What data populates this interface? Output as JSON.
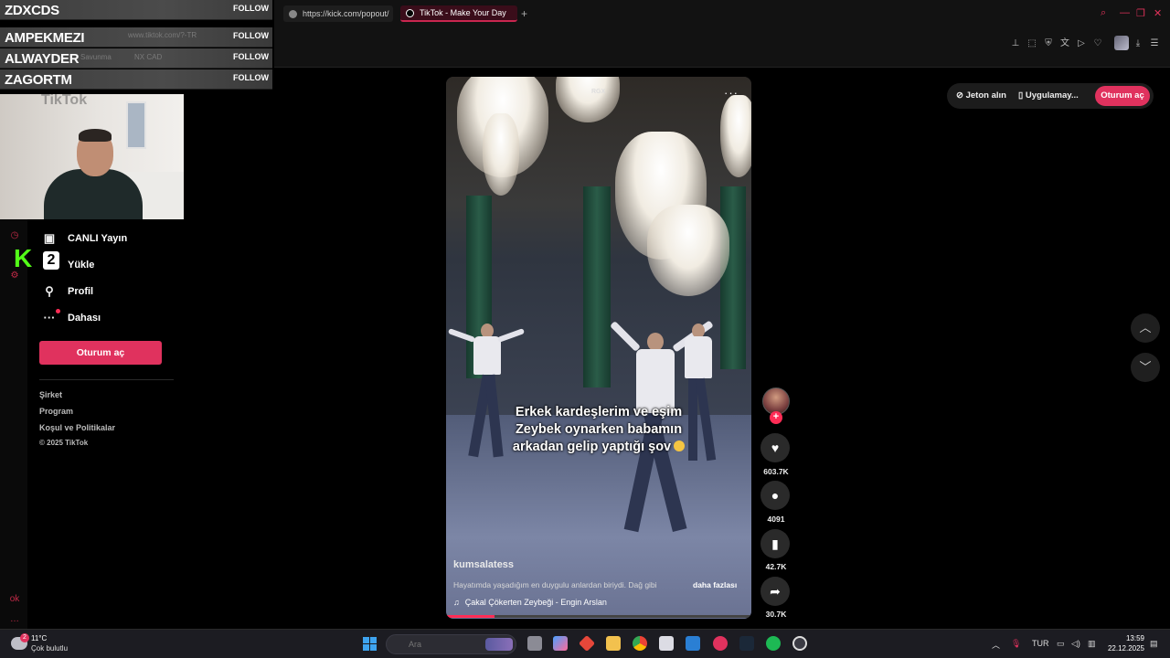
{
  "browser": {
    "tabs": [
      {
        "label": "https://kick.com/popout/"
      },
      {
        "label": "TikTok - Make Your Day"
      }
    ],
    "new_tab": "+"
  },
  "kick_overlay": {
    "followers": [
      {
        "name": "ZDXCDS",
        "action": "FOLLOW"
      },
      {
        "name": "AMPEKMEZI",
        "action": "FOLLOW"
      },
      {
        "name": "ALWAYDER",
        "action": "FOLLOW"
      },
      {
        "name": "ZAGORTM",
        "action": "FOLLOW"
      }
    ],
    "ghost_url": "www.tiktok.com/?-TR",
    "ghost_bar_1": "Savunma",
    "ghost_bar_2": "NX CAD",
    "ghost_logo": "TikTok"
  },
  "sidebar": {
    "items": [
      {
        "label": "CANLI Yayın",
        "icon": "live-icon"
      },
      {
        "label": "Yükle",
        "icon": "upload-icon"
      },
      {
        "label": "Profil",
        "icon": "profile-icon"
      },
      {
        "label": "Dahası",
        "icon": "more-icon"
      }
    ],
    "login_label": "Oturum aç",
    "footer": [
      "Şirket",
      "Program",
      "Koşul ve Politikalar"
    ],
    "copyright": "© 2025 TikTok",
    "kick_badge": "2"
  },
  "top_actions": {
    "coins_label": "Jeton alın",
    "app_label": "Uygulamay...",
    "login_label": "Oturum aç"
  },
  "video": {
    "watermark": "RGX",
    "menu": "···",
    "caption_lines": [
      "Erkek kardeşlerim ve eşim",
      "Zeybek oynarken babamın",
      "arkadan gelip yaptığı şov"
    ],
    "username": "kumsalatess",
    "description": "Hayatımda yaşadığım en duygulu anlardan biriydi. Dağ gibi",
    "more_label": "daha fazlası",
    "music": "Çakal Çökerten Zeybeği - Engin Arslan",
    "progress": 0.16
  },
  "actions": {
    "likes": "603.7K",
    "comments": "4091",
    "saves": "42.7K",
    "shares": "30.7K"
  },
  "taskbar": {
    "temperature": "11°C",
    "weather": "Çok bulutlu",
    "weather_badge": "2",
    "search_placeholder": "Ara",
    "language": "TUR",
    "time": "13:59",
    "date": "22.12.2025"
  },
  "colors": {
    "accent": "#e0325e",
    "kick_green": "#53fc18",
    "tiktok_red": "#fe2c55"
  }
}
